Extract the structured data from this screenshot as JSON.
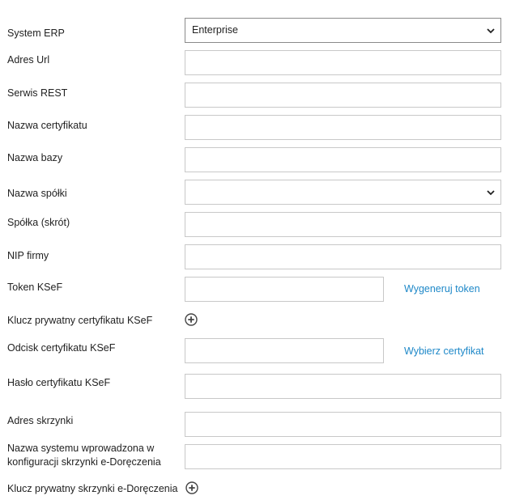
{
  "form": {
    "system_erp": {
      "label": "System ERP",
      "value": "Enterprise"
    },
    "adres_url": {
      "label": "Adres Url",
      "value": ""
    },
    "serwis_rest": {
      "label": "Serwis REST",
      "value": ""
    },
    "nazwa_certyfikatu": {
      "label": "Nazwa certyfikatu",
      "value": ""
    },
    "nazwa_bazy": {
      "label": "Nazwa bazy",
      "value": ""
    },
    "nazwa_spolki": {
      "label": "Nazwa spółki",
      "value": ""
    },
    "spolka_skrot": {
      "label": "Spółka (skrót)",
      "value": ""
    },
    "nip_firmy": {
      "label": "NIP firmy",
      "value": ""
    },
    "token_ksef": {
      "label": "Token KSeF",
      "value": "",
      "action": "Wygeneruj token"
    },
    "klucz_prywatny_ksef": {
      "label": "Klucz prywatny certyfikatu KSeF",
      "icon": "plus-circle-icon"
    },
    "odcisk_certyfikatu": {
      "label": "Odcisk certyfikatu KSeF",
      "value": "",
      "action": "Wybierz certyfikat"
    },
    "haslo_certyfikatu": {
      "label": "Hasło certyfikatu KSeF",
      "value": ""
    },
    "adres_skrzynki": {
      "label": "Adres skrzynki",
      "value": ""
    },
    "nazwa_systemu": {
      "label_line1": "Nazwa systemu wprowadzona w",
      "label_line2": "konfiguracji skrzynki e-Doręczenia",
      "value": ""
    },
    "klucz_prywatny_skrzynki": {
      "label": "Klucz prywatny skrzynki e-Doręczenia",
      "icon": "plus-circle-icon"
    }
  },
  "colors": {
    "link": "#1e88c8",
    "border": "#c8c8c8",
    "text": "#222222"
  }
}
